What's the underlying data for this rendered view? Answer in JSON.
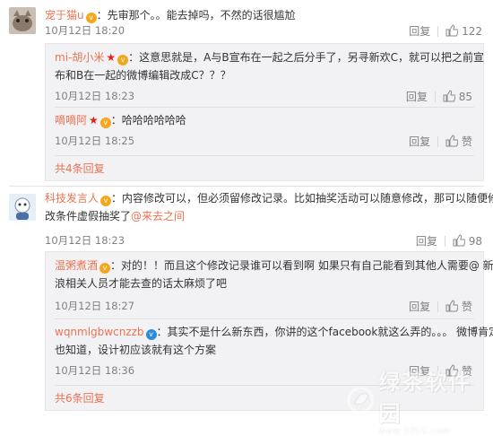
{
  "comments": [
    {
      "username": "宠于猫u",
      "text": "：先审那个。。能去掉吗，不然的话很尴尬",
      "time": "10月12日 18:20",
      "reply_label": "回复",
      "likes": "122"
    },
    {
      "username": "科技发言人",
      "text_line1": "：内容修改可以，但必须留修改记录。比如抽奖活动可以随意修改，那可以随便修",
      "text_line2": "改条件虚假抽奖了",
      "mention": "@来去之间",
      "time": "10月12日 18:23",
      "reply_label": "回复",
      "likes": "98"
    }
  ],
  "replies_1": [
    {
      "username": "mi-胡小米",
      "text_line1": "：这意思就是，A与B宣布在一起之后分手了，另寻新欢C，就可以把之前宣",
      "text_line2": "布和B在一起的微博编辑改成C？？？",
      "time": "10月12日 18:23",
      "reply_label": "回复",
      "likes": "85"
    },
    {
      "username": "嘀嘀阿",
      "text": "：哈哈哈哈哈哈",
      "time": "10月12日 18:25",
      "reply_label": "回复",
      "likes": "赞"
    }
  ],
  "more_1": "共4条回复",
  "replies_2": [
    {
      "username": "温粥煮酒",
      "text_line1": "：对的！！而且这个修改记录谁可以看到啊 如果只有自己能看到其他人需要@ 新",
      "text_line2": "浪相关人员才能去查的话太麻烦了吧",
      "time": "10月12日 18:27",
      "reply_label": "回复",
      "likes": "赞"
    },
    {
      "username": "wqnmlgbwcnzzb",
      "text_line1": "：其实不是什么新东西，你讲的这个facebook就这么弄的。。。 微博肯定",
      "text_line2": "也知道，设计初应该就有这个方案",
      "time": "10月12日 18:36",
      "reply_label": "回复",
      "likes": "赞"
    }
  ],
  "more_2": "共6条回复",
  "watermark": {
    "title": "绿茶软件园",
    "url": "www.33LC.com"
  }
}
